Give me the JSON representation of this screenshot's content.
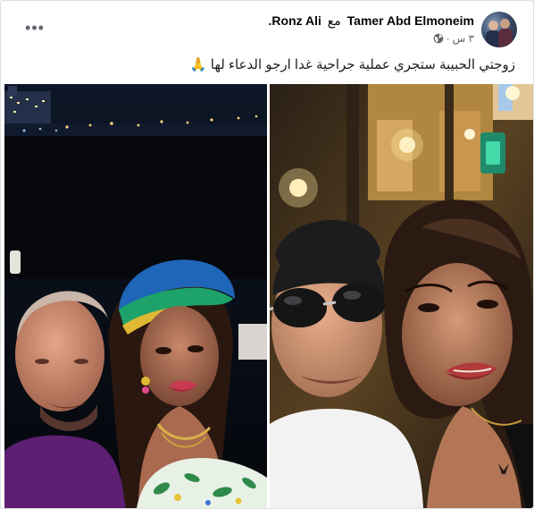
{
  "post": {
    "author": "Tamer Abd Elmoneim",
    "with_word": "مع",
    "tagged": "Ronz Ali.",
    "time": "٣ س",
    "separator": "·",
    "privacy_icon": "globe-icon",
    "more_icon": "more-options-icon",
    "more_label": "•••",
    "caption": "زوجتي الحبيبة ستجري عملية جراحية غدا ارجو الدعاء لها 🙏",
    "photos": [
      {
        "name": "photo-left",
        "scene": "couple selfie at night by the sea"
      },
      {
        "name": "photo-right",
        "scene": "couple selfie at night outdoors"
      }
    ]
  },
  "colors": {
    "card_bg": "#ffffff",
    "page_bg": "#f0f2f5",
    "text_primary": "#050505",
    "text_secondary": "#65676b"
  }
}
